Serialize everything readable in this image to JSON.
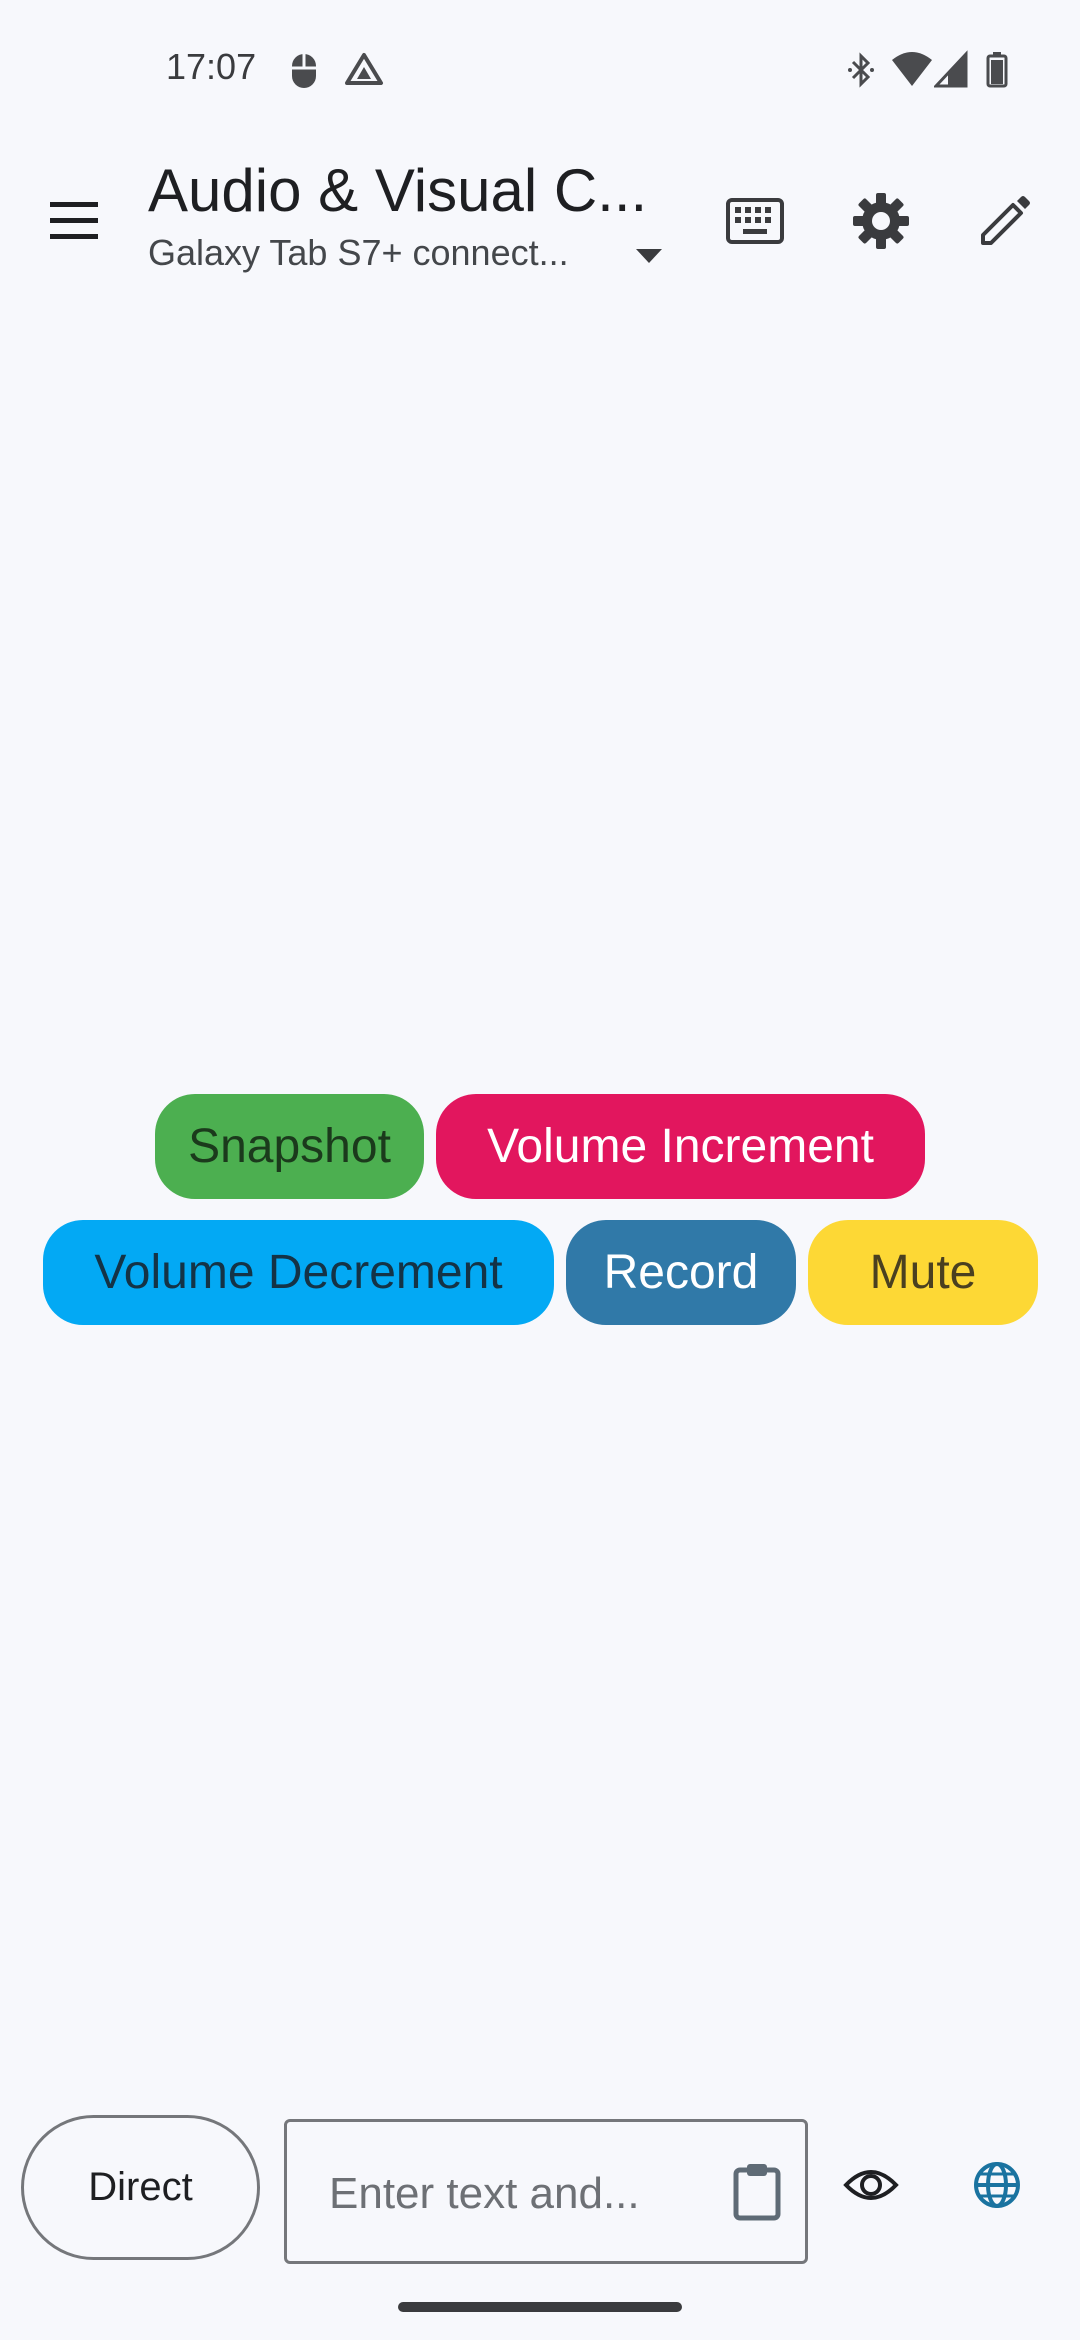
{
  "status_bar": {
    "time": "17:07",
    "left_icons": [
      "mouse-icon",
      "drive-icon"
    ],
    "right_icons": [
      "bluetooth-icon",
      "wifi-icon",
      "signal-icon",
      "battery-icon"
    ]
  },
  "app_bar": {
    "title": "Audio & Visual C...",
    "subtitle": "Galaxy Tab S7+ connect...",
    "actions": [
      "keyboard-icon",
      "gear-icon",
      "pencil-icon"
    ]
  },
  "chips": [
    {
      "label": "Snapshot",
      "color": "#4caf50",
      "text_color": "#1b3a1c"
    },
    {
      "label": "Volume Increment",
      "color": "#e2165e",
      "text_color": "#ffffff"
    },
    {
      "label": "Volume Decrement",
      "color": "#03a9f4",
      "text_color": "#143346"
    },
    {
      "label": "Record",
      "color": "#3079a8",
      "text_color": "#ffffff"
    },
    {
      "label": "Mute",
      "color": "#fdd835",
      "text_color": "#4a4020"
    }
  ],
  "bottom_bar": {
    "direct_label": "Direct",
    "input_placeholder": "Enter text and...",
    "input_value": ""
  },
  "colors": {
    "background": "#f7f8fc",
    "accent": "#1a73a0"
  }
}
